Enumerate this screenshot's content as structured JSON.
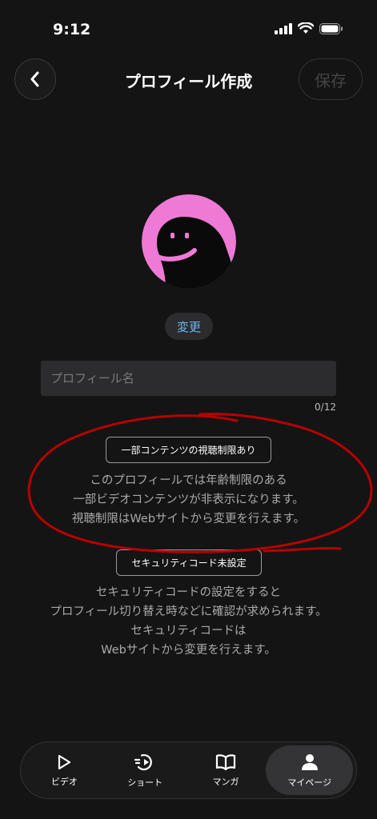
{
  "status_bar": {
    "time": "9:12"
  },
  "header": {
    "title": "プロフィール作成",
    "save_label": "保存"
  },
  "profile": {
    "change_label": "変更",
    "name_placeholder": "プロフィール名",
    "name_value": "",
    "counter": "0/12"
  },
  "restriction": {
    "badge": "一部コンテンツの視聴制限あり",
    "lines": [
      "このプロフィールでは年齢制限のある",
      "一部ビデオコンテンツが非表示になります。",
      "視聴制限はWebサイトから変更を行えます。"
    ]
  },
  "security": {
    "badge": "セキュリティコード未設定",
    "lines": [
      "セキュリティコードの設定をすると",
      "プロフィール切り替え時などに確認が求められます。",
      "セキュリティコードは",
      "Webサイトから変更を行えます。"
    ]
  },
  "tabs": [
    {
      "label": "ビデオ",
      "icon": "play-icon"
    },
    {
      "label": "ショート",
      "icon": "short-play-icon"
    },
    {
      "label": "マンガ",
      "icon": "book-icon"
    },
    {
      "label": "マイページ",
      "icon": "person-icon",
      "active": true
    }
  ],
  "colors": {
    "accent": "#6fb6ee",
    "avatar": "#ee7ad6",
    "annotation": "#b80000"
  }
}
